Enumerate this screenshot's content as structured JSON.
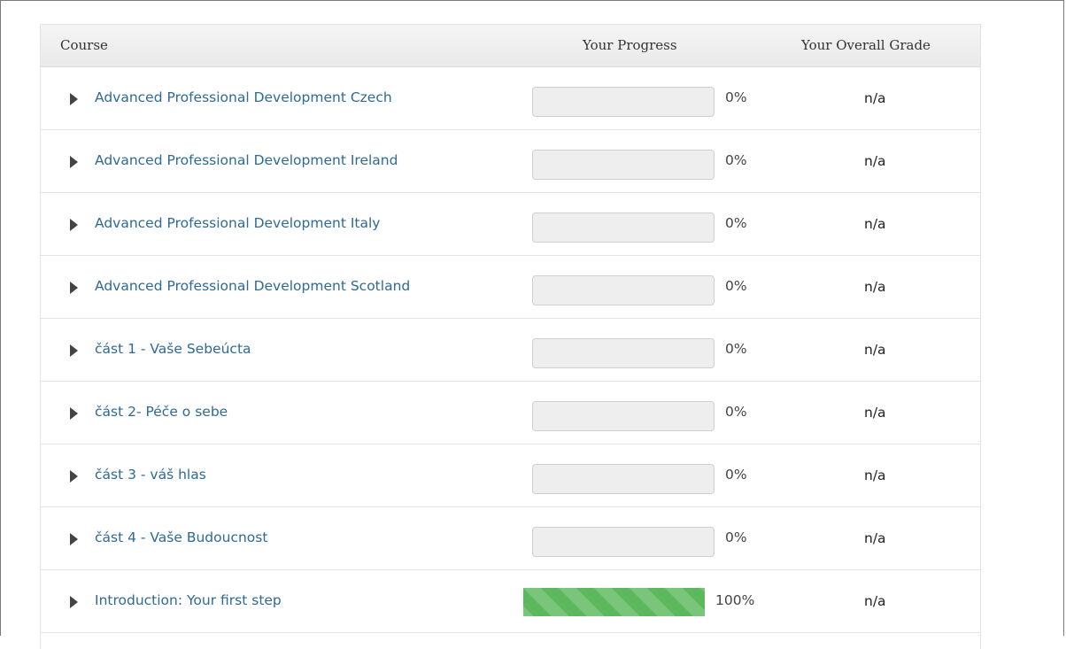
{
  "table": {
    "headers": {
      "course": "Course",
      "progress": "Your Progress",
      "grade": "Your Overall Grade"
    },
    "rows": [
      {
        "course": "Advanced Professional Development Czech",
        "progress": 0,
        "progress_label": "0%",
        "grade": "n/a"
      },
      {
        "course": "Advanced Professional Development Ireland",
        "progress": 0,
        "progress_label": "0%",
        "grade": "n/a"
      },
      {
        "course": "Advanced Professional Development Italy",
        "progress": 0,
        "progress_label": "0%",
        "grade": "n/a"
      },
      {
        "course": "Advanced Professional Development Scotland",
        "progress": 0,
        "progress_label": "0%",
        "grade": "n/a"
      },
      {
        "course": "část 1 - Vaše Sebeúcta",
        "progress": 0,
        "progress_label": "0%",
        "grade": "n/a"
      },
      {
        "course": "část 2- Péče o sebe",
        "progress": 0,
        "progress_label": "0%",
        "grade": "n/a"
      },
      {
        "course": "část 3 - váš hlas",
        "progress": 0,
        "progress_label": "0%",
        "grade": "n/a"
      },
      {
        "course": "část 4 - Vaše Budoucnost",
        "progress": 0,
        "progress_label": "0%",
        "grade": "n/a"
      },
      {
        "course": "Introduction: Your first step",
        "progress": 100,
        "progress_label": "100%",
        "grade": "n/a"
      }
    ]
  },
  "colors": {
    "link": "#2e6a95",
    "progress_fill": "#5cb85c",
    "progress_track": "#eeeeee"
  },
  "icons": {
    "row_toggle": "caret-right-icon"
  }
}
